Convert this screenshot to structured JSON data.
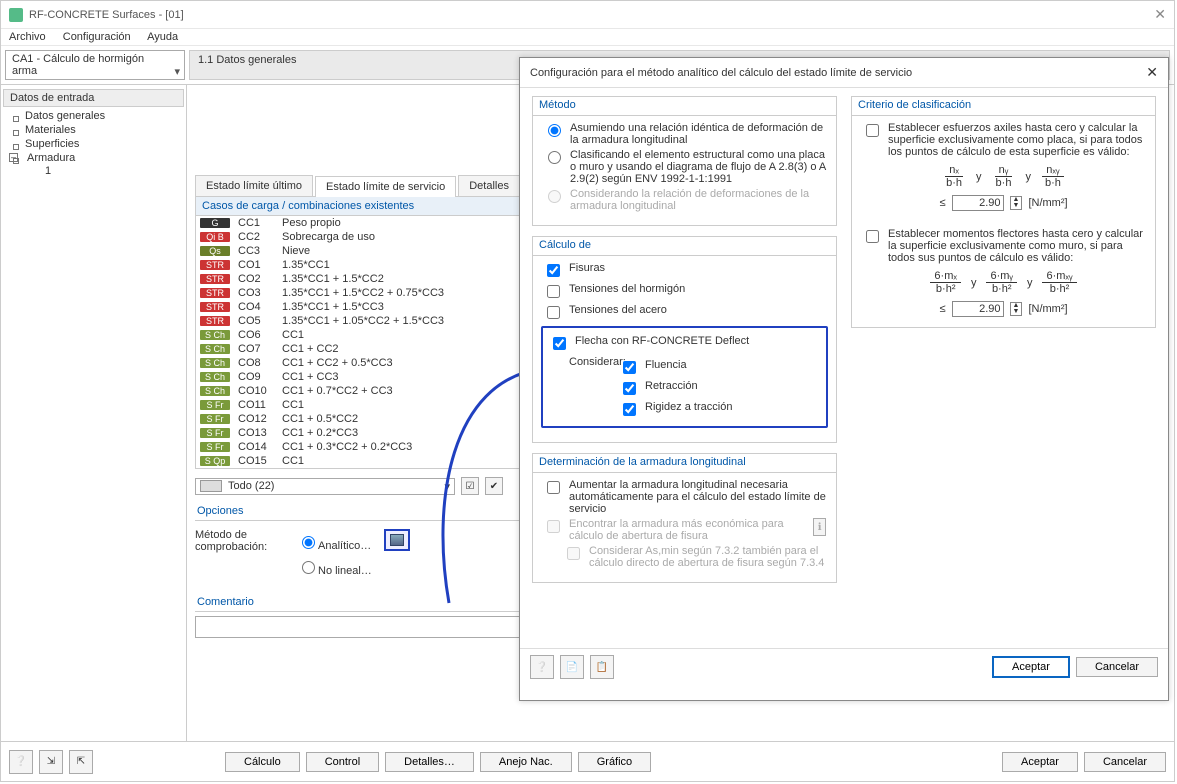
{
  "window": {
    "title": "RF-CONCRETE Surfaces - [01]"
  },
  "menu": {
    "file": "Archivo",
    "config": "Configuración",
    "help": "Ayuda"
  },
  "combo_ca": "CA1 - Cálculo de hormigón arma",
  "header_title": "1.1 Datos generales",
  "tree": {
    "root": "Datos de entrada",
    "items": [
      "Datos generales",
      "Materiales",
      "Superficies"
    ],
    "arm": "Armadura",
    "arm_child": "1"
  },
  "tabs": {
    "ult": "Estado límite último",
    "serv": "Estado límite de servicio",
    "det": "Detalles"
  },
  "lc_header": "Casos de carga / combinaciones existentes",
  "rows": [
    {
      "tag": "G",
      "cls": "tag-G",
      "id": "CC1",
      "desc": "Peso propio"
    },
    {
      "tag": "Qi B",
      "cls": "tag-Qi",
      "id": "CC2",
      "desc": "Sobrecarga de uso"
    },
    {
      "tag": "Qs",
      "cls": "tag-Qs",
      "id": "CC3",
      "desc": "Nieve"
    },
    {
      "tag": "STR",
      "cls": "tag-STR",
      "id": "CO1",
      "desc": "1.35*CC1"
    },
    {
      "tag": "STR",
      "cls": "tag-STR",
      "id": "CO2",
      "desc": "1.35*CC1 + 1.5*CC2"
    },
    {
      "tag": "STR",
      "cls": "tag-STR",
      "id": "CO3",
      "desc": "1.35*CC1 + 1.5*CC2 + 0.75*CC3"
    },
    {
      "tag": "STR",
      "cls": "tag-STR",
      "id": "CO4",
      "desc": "1.35*CC1 + 1.5*CC3"
    },
    {
      "tag": "STR",
      "cls": "tag-STR",
      "id": "CO5",
      "desc": "1.35*CC1 + 1.05*CC2 + 1.5*CC3"
    },
    {
      "tag": "S Ch",
      "cls": "tag-SCh",
      "id": "CO6",
      "desc": "CC1"
    },
    {
      "tag": "S Ch",
      "cls": "tag-SCh",
      "id": "CO7",
      "desc": "CC1 + CC2"
    },
    {
      "tag": "S Ch",
      "cls": "tag-SCh",
      "id": "CO8",
      "desc": "CC1 + CC2 + 0.5*CC3"
    },
    {
      "tag": "S Ch",
      "cls": "tag-SCh",
      "id": "CO9",
      "desc": "CC1 + CC3"
    },
    {
      "tag": "S Ch",
      "cls": "tag-SCh",
      "id": "CO10",
      "desc": "CC1 + 0.7*CC2 + CC3"
    },
    {
      "tag": "S Fr",
      "cls": "tag-SFr",
      "id": "CO11",
      "desc": "CC1"
    },
    {
      "tag": "S Fr",
      "cls": "tag-SFr",
      "id": "CO12",
      "desc": "CC1 + 0.5*CC2"
    },
    {
      "tag": "S Fr",
      "cls": "tag-SFr",
      "id": "CO13",
      "desc": "CC1 + 0.2*CC3"
    },
    {
      "tag": "S Fr",
      "cls": "tag-SFr",
      "id": "CO14",
      "desc": "CC1 + 0.3*CC2 + 0.2*CC3"
    },
    {
      "tag": "S Qp",
      "cls": "tag-SQp",
      "id": "CO15",
      "desc": "CC1"
    }
  ],
  "todo": "Todo (22)",
  "options": {
    "title": "Opciones",
    "label": "Método de comprobación:",
    "analytic": "Analítico…",
    "nonlinear": "No lineal…"
  },
  "comment": {
    "title": "Comentario"
  },
  "bottom": {
    "calc": "Cálculo",
    "control": "Control",
    "details": "Detalles…",
    "anejo": "Anejo Nac.",
    "graf": "Gráfico",
    "ok": "Aceptar",
    "cancel": "Cancelar"
  },
  "dialog": {
    "title": "Configuración para el método analítico del cálculo del estado límite de servicio",
    "method": {
      "legend": "Método",
      "opt1": "Asumiendo una relación idéntica de deformación de la armadura longitudinal",
      "opt2": "Clasificando el elemento estructural como una placa o muro y usando el diagrama de flujo de A 2.8(3) o A 2.9(2) según ENV 1992-1-1:1991",
      "opt3": "Considerando la relación de deformaciones de la armadura longitudinal"
    },
    "calc": {
      "legend": "Cálculo de",
      "fisuras": "Fisuras",
      "tens_h": "Tensiones del hormigón",
      "tens_a": "Tensiones del acero",
      "deflect": "Flecha con RF-CONCRETE Deflect",
      "consider": "Considerar:",
      "fluencia": "Fluencia",
      "retr": "Retracción",
      "rig": "Rigidez a tracción"
    },
    "det": {
      "legend": "Determinación de la armadura longitudinal",
      "aumentar": "Aumentar la armadura longitudinal necesaria automáticamente para el cálculo del estado límite de servicio",
      "econ": "Encontrar la armadura más económica para cálculo de abertura de fisura",
      "asmin": "Considerar As,min según 7.3.2 también para el cálculo directo de abertura de fisura según 7.3.4"
    },
    "crit": {
      "legend": "Criterio de clasificación",
      "axiles": "Establecer esfuerzos axiles hasta cero y calcular la superficie exclusivamente como placa, si para todos los puntos de cálculo de esta superficie es válido:",
      "flect": "Establecer momentos flectores hasta cero y calcular la superficie exclusivamente como muro, si para todos sus puntos de cálculo es válido:",
      "val": "2.90",
      "unit": "[N/mm²]",
      "le": "≤",
      "y": "y"
    },
    "frac1": [
      {
        "n": "nₓ",
        "d": "b·h"
      },
      {
        "n": "nᵧ",
        "d": "b·h"
      },
      {
        "n": "nₓᵧ",
        "d": "b·h"
      }
    ],
    "frac2": [
      {
        "n": "6·mₓ",
        "d": "b·h²"
      },
      {
        "n": "6·mᵧ",
        "d": "b·h²"
      },
      {
        "n": "6·mₓᵧ",
        "d": "b·h²"
      }
    ],
    "ok": "Aceptar",
    "cancel": "Cancelar"
  }
}
